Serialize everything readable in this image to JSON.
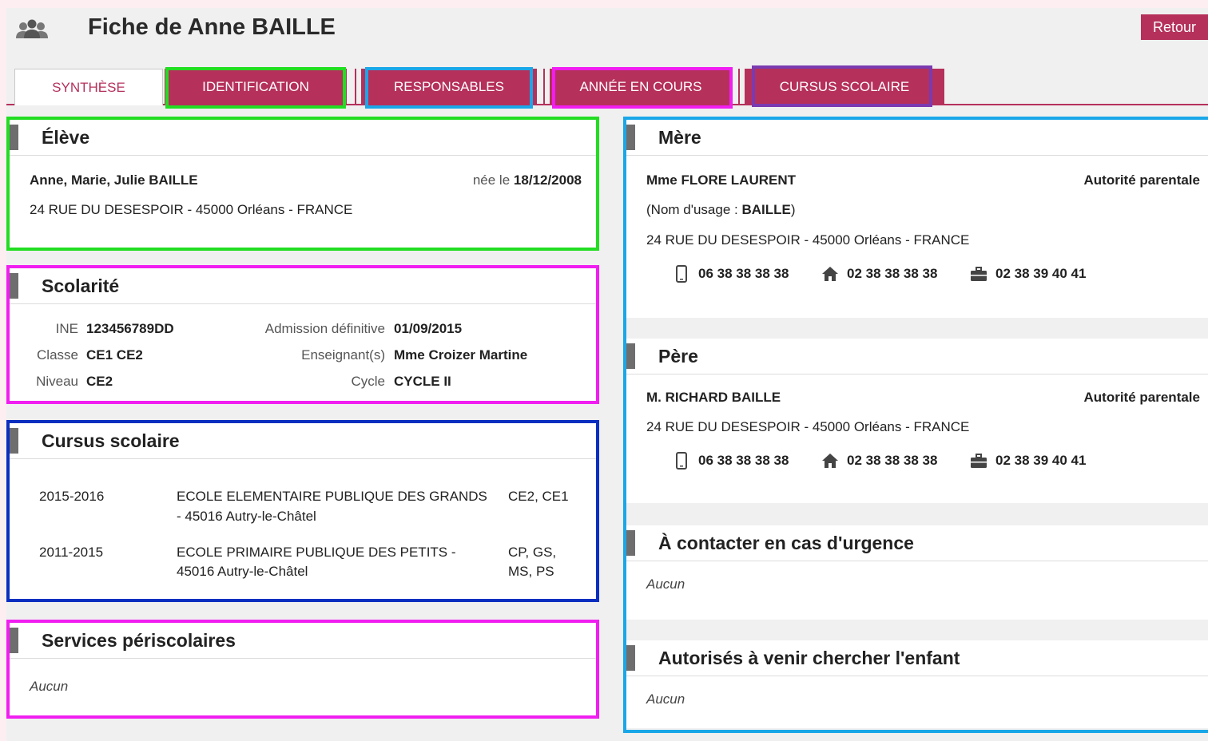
{
  "header": {
    "title": "Fiche de Anne BAILLE",
    "back_label": "Retour",
    "icon": "people-icon"
  },
  "tabs": [
    {
      "label": "SYNTHÈSE",
      "active": true
    },
    {
      "label": "IDENTIFICATION",
      "active": false
    },
    {
      "label": "RESPONSABLES",
      "active": false
    },
    {
      "label": "ANNÉE EN COURS",
      "active": false
    },
    {
      "label": "CURSUS SCOLAIRE",
      "active": false
    }
  ],
  "eleve": {
    "title": "Élève",
    "name": "Anne, Marie, Julie BAILLE",
    "born_label": "née le",
    "born_date": "18/12/2008",
    "address": "24 RUE DU DESESPOIR - 45000 Orléans - FRANCE"
  },
  "scolarite": {
    "title": "Scolarité",
    "ine_label": "INE",
    "ine": "123456789DD",
    "classe_label": "Classe",
    "classe": "CE1 CE2",
    "niveau_label": "Niveau",
    "niveau": "CE2",
    "admission_label": "Admission définitive",
    "admission": "01/09/2015",
    "enseignant_label": "Enseignant(s)",
    "enseignant": "Mme Croizer Martine",
    "cycle_label": "Cycle",
    "cycle": "CYCLE II"
  },
  "cursus": {
    "title": "Cursus scolaire",
    "rows": [
      {
        "years": "2015-2016",
        "school_l1": "ECOLE ELEMENTAIRE PUBLIQUE DES GRANDS",
        "school_l2": "- 45016 Autry-le-Châtel",
        "levels_l1": "CE2, CE1",
        "levels_l2": ""
      },
      {
        "years": "2011-2015",
        "school_l1": "ECOLE PRIMAIRE PUBLIQUE DES PETITS -",
        "school_l2": "45016 Autry-le-Châtel",
        "levels_l1": "CP, GS,",
        "levels_l2": "MS, PS"
      }
    ]
  },
  "periscolaire": {
    "title": "Services périscolaires",
    "value": "Aucun"
  },
  "mere": {
    "title": "Mère",
    "name": "Mme FLORE LAURENT",
    "authority": "Autorité parentale",
    "usage_prefix": "(Nom d'usage : ",
    "usage_name": "BAILLE",
    "usage_suffix": ")",
    "address": "24 RUE DU DESESPOIR - 45000 Orléans - FRANCE",
    "mobile": "06 38 38 38 38",
    "home": "02 38 38 38 38",
    "work": "02 38 39 40 41"
  },
  "pere": {
    "title": "Père",
    "name": "M. RICHARD BAILLE",
    "authority": "Autorité parentale",
    "address": "24 RUE DU DESESPOIR - 45000 Orléans - FRANCE",
    "mobile": "06 38 38 38 38",
    "home": "02 38 38 38 38",
    "work": "02 38 39 40 41"
  },
  "urgence": {
    "title": "À contacter en cas d'urgence",
    "value": "Aucun"
  },
  "autorises": {
    "title": "Autorisés à venir chercher l'enfant",
    "value": "Aucun"
  },
  "colors": {
    "accent": "#b5305b",
    "outline_green": "#22dd22",
    "outline_cyan": "#1aa7e8",
    "outline_magenta": "#f01ef0",
    "outline_purple": "#7a3ab0",
    "outline_blue": "#0a2fc0"
  }
}
